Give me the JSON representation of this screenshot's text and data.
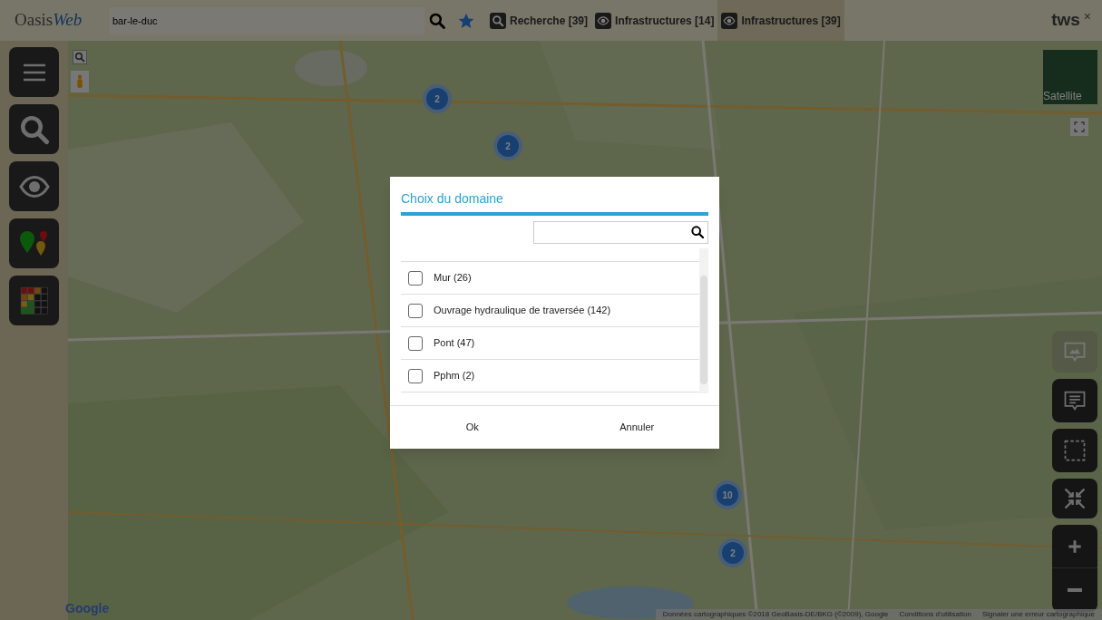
{
  "top_bar": {
    "logo": {
      "part_1": "Oasis",
      "part_2": "Web"
    },
    "search": {
      "value": "bar-le-duc"
    },
    "tabs": [
      {
        "label": "Recherche [39]",
        "kind": "search",
        "selected": false
      },
      {
        "label": "Infrastructures [14]",
        "kind": "eye",
        "selected": false
      },
      {
        "label": "Infrastructures [39]",
        "kind": "eye",
        "selected": true
      }
    ],
    "brand": "tws",
    "close": "×"
  },
  "map": {
    "clusters": [
      {
        "count": "2"
      },
      {
        "count": "2"
      },
      {
        "count": "10"
      },
      {
        "count": "2"
      }
    ],
    "satellite_label": "Satellite",
    "google_label": "Google",
    "attribution": [
      "Données cartographiques ©2018 GeoBasis-DE/BKG (©2009), Google",
      "Conditions d'utilisation",
      "Signaler une erreur cartographique"
    ]
  },
  "dialog": {
    "title": "Choix du domaine",
    "items": [
      {
        "label": "Mur (26)",
        "checked": false
      },
      {
        "label": "Ouvrage hydraulique de traversée (142)",
        "checked": false
      },
      {
        "label": "Pont (47)",
        "checked": false
      },
      {
        "label": "Pphm (2)",
        "checked": false
      }
    ],
    "buttons": [
      "Ok",
      "Annuler"
    ]
  }
}
